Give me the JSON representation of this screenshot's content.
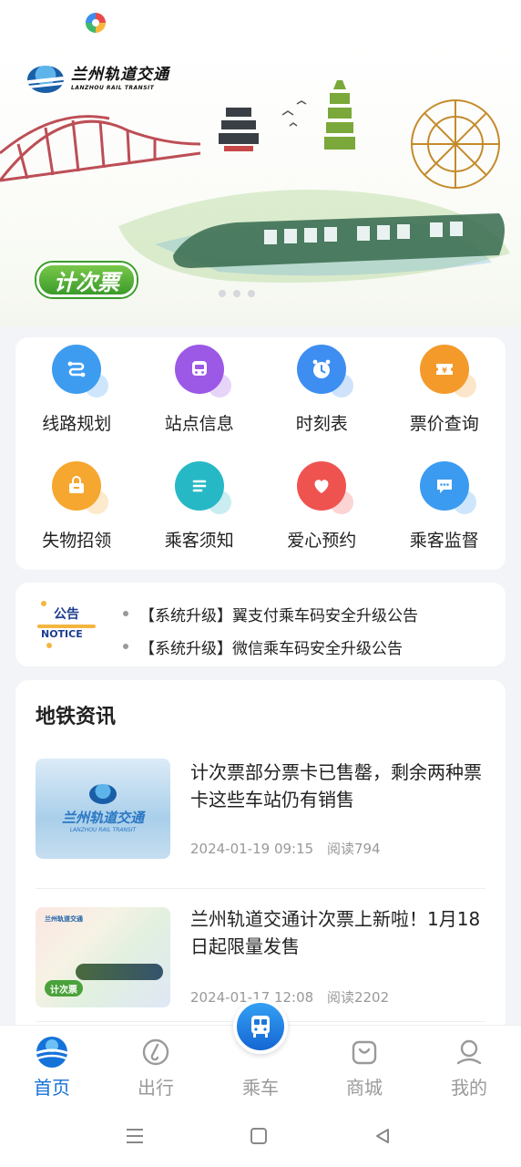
{
  "banner": {
    "logo_cn": "兰州轨道交通",
    "logo_en": "LANZHOU RAIL TRANSIT",
    "badge": "计次票"
  },
  "quick_menu": [
    {
      "label": "线路规划",
      "icon": "route-icon",
      "color": "#3d9cf0"
    },
    {
      "label": "站点信息",
      "icon": "station-icon",
      "color": "#9b59e6"
    },
    {
      "label": "时刻表",
      "icon": "clock-icon",
      "color": "#3d8ef0"
    },
    {
      "label": "票价查询",
      "icon": "ticket-icon",
      "color": "#f39a2b"
    },
    {
      "label": "失物招领",
      "icon": "lost-found-icon",
      "color": "#f6a72f"
    },
    {
      "label": "乘客须知",
      "icon": "notice-list-icon",
      "color": "#27b8c6"
    },
    {
      "label": "爱心预约",
      "icon": "heart-icon",
      "color": "#ef5350"
    },
    {
      "label": "乘客监督",
      "icon": "chat-icon",
      "color": "#3b9bf0"
    }
  ],
  "notice": {
    "mark_cn": "公告",
    "mark_en": "NOTICE",
    "items": [
      "【系统升级】翼支付乘车码安全升级公告",
      "【系统升级】微信乘车码安全升级公告"
    ]
  },
  "news": {
    "section_title": "地铁资讯",
    "items": [
      {
        "title": "计次票部分票卡已售罄，剩余两种票卡这些车站仍有销售",
        "date": "2024-01-19 09:15",
        "reads": "阅读794",
        "thumb_cn": "兰州轨道交通",
        "thumb_en": "LANZHOU RAIL TRANSIT"
      },
      {
        "title": "兰州轨道交通计次票上新啦！1月18日起限量发售",
        "date": "2024-01-17 12:08",
        "reads": "阅读2202",
        "thumb_logo": "兰州轨道交通",
        "thumb_badge": "计次票"
      }
    ]
  },
  "tabs": [
    {
      "label": "首页",
      "icon": "home-icon",
      "active": true
    },
    {
      "label": "出行",
      "icon": "travel-icon",
      "active": false
    },
    {
      "label": "乘车",
      "icon": "bus-icon",
      "active": false
    },
    {
      "label": "商城",
      "icon": "shop-icon",
      "active": false
    },
    {
      "label": "我的",
      "icon": "profile-icon",
      "active": false
    }
  ],
  "colors": {
    "accent": "#1572d9",
    "inactive_tab": "#9a9a9a",
    "background": "#f2f4f7"
  }
}
